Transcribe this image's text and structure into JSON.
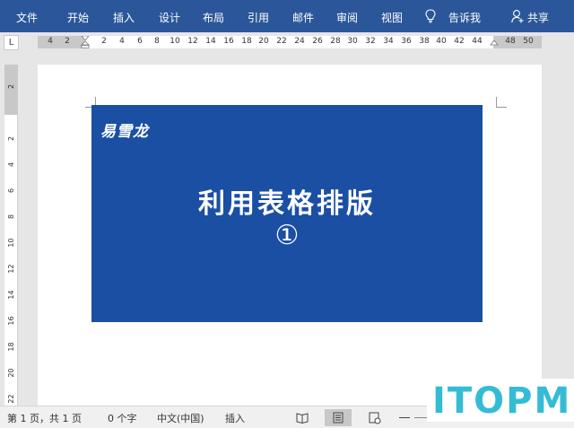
{
  "ribbon": {
    "tabs": [
      {
        "label": "文件"
      },
      {
        "label": "开始"
      },
      {
        "label": "插入"
      },
      {
        "label": "设计"
      },
      {
        "label": "布局"
      },
      {
        "label": "引用"
      },
      {
        "label": "邮件"
      },
      {
        "label": "审阅"
      },
      {
        "label": "视图"
      }
    ],
    "tell_me": "告诉我",
    "share": "共享",
    "background": "#2b579a"
  },
  "ruler": {
    "tab_selector": "L",
    "horizontal_numbers": [
      "4",
      "2",
      "2",
      "4",
      "6",
      "8",
      "10",
      "12",
      "14",
      "16",
      "18",
      "20",
      "22",
      "24",
      "26",
      "28",
      "30",
      "32",
      "34",
      "36",
      "38",
      "40",
      "42",
      "44",
      "48",
      "50"
    ],
    "vertical_numbers": [
      "2",
      "2",
      "4",
      "6",
      "8",
      "10",
      "12",
      "14",
      "16",
      "18",
      "20",
      "22"
    ]
  },
  "document": {
    "brand": "易雪龙",
    "title": "利用表格排版",
    "number": "①",
    "banner_color": "#1a4fa3"
  },
  "status": {
    "page": "第 1 页，共 1 页",
    "words": "0 个字",
    "language": "中文(中国)",
    "mode": "插入"
  },
  "watermark": {
    "text": "ITOPM",
    "color": "#35bcd5"
  }
}
